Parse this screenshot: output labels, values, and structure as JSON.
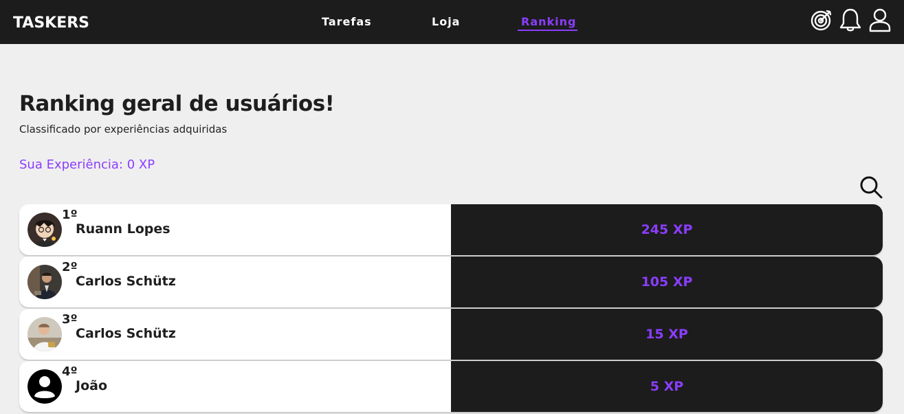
{
  "header": {
    "brand": "TASKERS",
    "nav": [
      {
        "label": "Tarefas",
        "active": false
      },
      {
        "label": "Loja",
        "active": false
      },
      {
        "label": "Ranking",
        "active": true
      }
    ],
    "icons": [
      "target-icon",
      "bell-icon",
      "user-icon"
    ]
  },
  "main": {
    "title": "Ranking geral de usuários!",
    "subtitle": "Classificado por experiências adquiridas",
    "your_xp": "Sua Experiência: 0 XP",
    "search_icon": "search-icon"
  },
  "ranking": [
    {
      "position": "1º",
      "name": "Ruann Lopes",
      "xp": "245 XP",
      "avatar": "cartoon-avatar"
    },
    {
      "position": "2º",
      "name": "Carlos Schütz",
      "xp": "105 XP",
      "avatar": "photo-avatar"
    },
    {
      "position": "3º",
      "name": "Carlos Schütz",
      "xp": "15 XP",
      "avatar": "photo-avatar"
    },
    {
      "position": "4º",
      "name": "João",
      "xp": "5 XP",
      "avatar": "default-user-avatar"
    }
  ],
  "colors": {
    "accent": "#8b3dff",
    "header_bg": "#1c1c1c",
    "page_bg": "#efefef",
    "row_left_bg": "#ffffff",
    "row_right_bg": "#1c1c1c"
  }
}
